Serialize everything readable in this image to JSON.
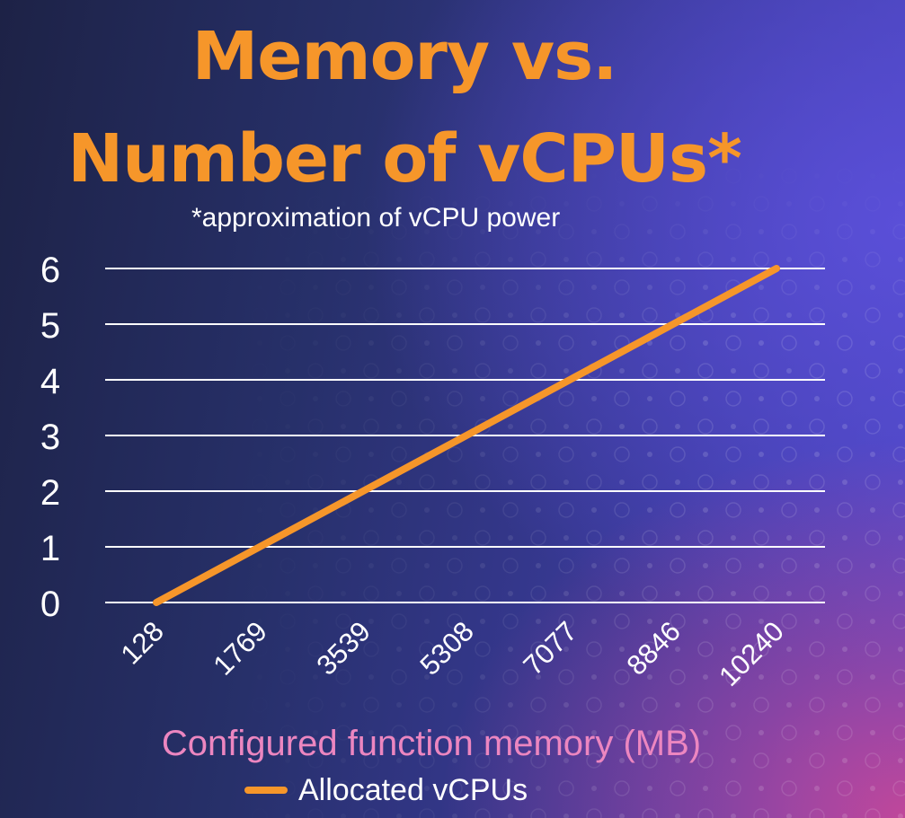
{
  "chart_data": {
    "type": "line",
    "title_lines": [
      "Memory vs.",
      "Number of vCPUs*"
    ],
    "subtitle": "*approximation of vCPU power",
    "xlabel": "Configured function memory (MB)",
    "ylabel": "",
    "categories": [
      "128",
      "1769",
      "3539",
      "5308",
      "7077",
      "8846",
      "10240"
    ],
    "y_ticks": [
      "0",
      "1",
      "2",
      "3",
      "4",
      "5",
      "6"
    ],
    "ylim": [
      0,
      6
    ],
    "grid": true,
    "legend_position": "bottom",
    "series": [
      {
        "name": "Allocated vCPUs",
        "values": [
          0,
          1,
          2,
          3,
          4,
          5,
          6
        ],
        "color": "#f6962a"
      }
    ]
  },
  "colors": {
    "title": "#f6962a",
    "xlabel": "#ec86c0",
    "grid": "#ffffff",
    "text": "#ffffff"
  }
}
